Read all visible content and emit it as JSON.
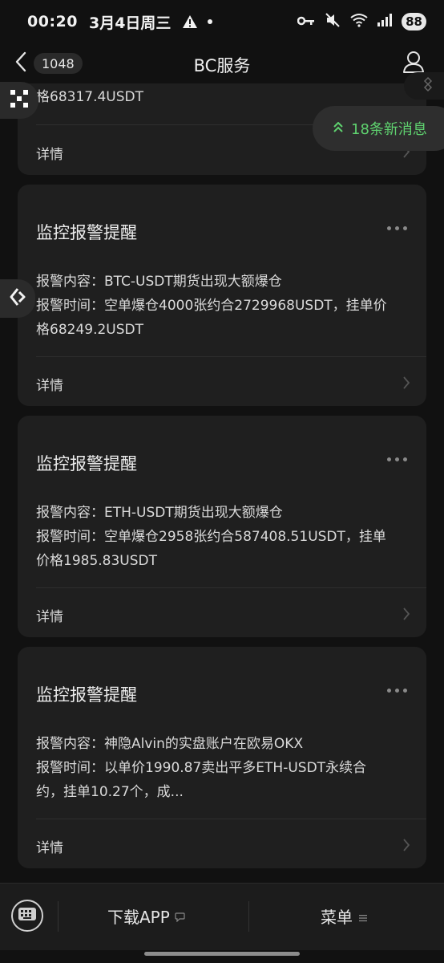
{
  "status_bar": {
    "time": "00:20",
    "date": "3月4日周三",
    "battery": "88"
  },
  "nav": {
    "unread_count": "1048",
    "title": "BC服务"
  },
  "new_messages": {
    "label": "18条新消息",
    "color": "#5fd26f"
  },
  "cards": [
    {
      "body_lines": [
        "格68317.4USDT"
      ],
      "detail_label": "详情"
    },
    {
      "title": "监控报警提醒",
      "body_lines": [
        "报警内容：BTC-USDT期货出现大额爆仓",
        "报警时间：空单爆仓4000张约合2729968USDT，挂单价",
        "格68249.2USDT"
      ],
      "detail_label": "详情"
    },
    {
      "title": "监控报警提醒",
      "body_lines": [
        "报警内容：ETH-USDT期货出现大额爆仓",
        "报警时间：空单爆仓2958张约合587408.51USDT，挂单",
        "价格1985.83USDT"
      ],
      "detail_label": "详情"
    },
    {
      "title": "监控报警提醒",
      "body_lines": [
        "报警内容：神隐Alvin的实盘账户在欧易OKX",
        "报警时间：以单价1990.87卖出平多ETH-USDT永续合",
        "约，挂单10.27个，成..."
      ],
      "detail_label": "详情"
    }
  ],
  "bottom_menu": {
    "download_label": "下载APP",
    "menu_label": "菜单"
  },
  "colors": {
    "background": "#111111",
    "card": "#1f1f1f",
    "accent_green": "#5fd26f"
  }
}
